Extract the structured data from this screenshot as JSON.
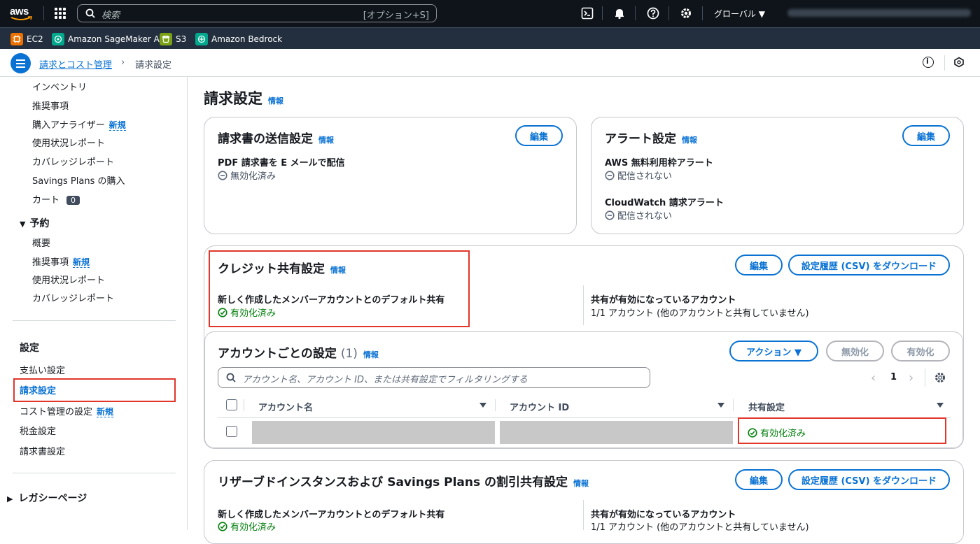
{
  "topbar": {
    "search_placeholder": "検索",
    "search_shortcut": "[オプション+S]",
    "region": "グローバル ▼"
  },
  "services": [
    {
      "label": "EC2",
      "color": "#ed7100"
    },
    {
      "label": "Amazon SageMaker AI",
      "color": "#01a88d"
    },
    {
      "label": "S3",
      "color": "#7aa116"
    },
    {
      "label": "Amazon Bedrock",
      "color": "#01a88d"
    }
  ],
  "breadcrumb": {
    "parent": "請求とコスト管理",
    "current": "請求設定"
  },
  "sidebar": {
    "items": [
      "インベントリ",
      "推奨事項",
      "購入アナライザー",
      "使用状況レポート",
      "カバレッジレポート",
      "Savings Plans の購入",
      "カート"
    ],
    "cart_count": "0",
    "new_label": "新規",
    "reservation_head": "予約",
    "reservation_items": [
      "概要",
      "推奨事項",
      "使用状況レポート",
      "カバレッジレポート"
    ],
    "settings_head": "設定",
    "settings_items": [
      "支払い設定",
      "請求設定",
      "コスト管理の設定",
      "税金設定",
      "請求書設定"
    ],
    "legacy": "レガシーページ"
  },
  "page": {
    "title": "請求設定",
    "info": "情報"
  },
  "invoice_card": {
    "title": "請求書の送信設定",
    "edit": "編集",
    "pdf_label": "PDF 請求書を E メールで配信",
    "pdf_value": "無効化済み"
  },
  "alert_card": {
    "title": "アラート設定",
    "edit": "編集",
    "free_tier_label": "AWS 無料利用枠アラート",
    "free_tier_value": "配信されない",
    "cloudwatch_label": "CloudWatch 請求アラート",
    "cloudwatch_value": "配信されない"
  },
  "credit_card": {
    "title": "クレジット共有設定",
    "edit": "編集",
    "download": "設定履歴 (CSV) をダウンロード",
    "default_label": "新しく作成したメンバーアカウントとのデフォルト共有",
    "default_value": "有効化済み",
    "enabled_label": "共有が有効になっているアカウント",
    "enabled_value": "1/1 アカウント (他のアカウントと共有していません)"
  },
  "account_table": {
    "title": "アカウントごとの設定",
    "count": "(1)",
    "action": "アクション ▼",
    "disable": "無効化",
    "enable": "有効化",
    "filter_placeholder": "アカウント名、アカウント ID、または共有設定でフィルタリングする",
    "page": "1",
    "columns": [
      "アカウント名",
      "アカウント ID",
      "共有設定"
    ],
    "rows": [
      {
        "status": "有効化済み"
      }
    ]
  },
  "ri_card": {
    "title": "リザーブドインスタンスおよび Savings Plans の割引共有設定",
    "edit": "編集",
    "download": "設定履歴 (CSV) をダウンロード",
    "default_label": "新しく作成したメンバーアカウントとのデフォルト共有",
    "default_value": "有効化済み",
    "enabled_label": "共有が有効になっているアカウント",
    "enabled_value": "1/1 アカウント (他のアカウントと共有していません)"
  }
}
